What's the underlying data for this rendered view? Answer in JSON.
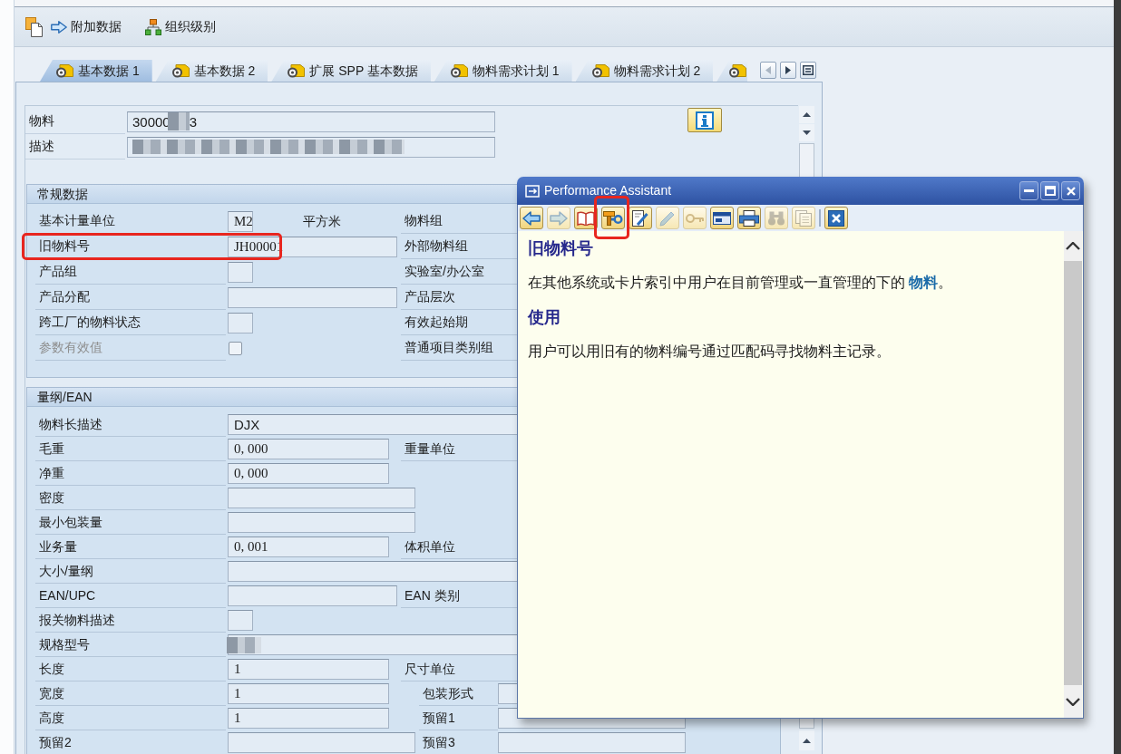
{
  "toolbar": {
    "items": [
      {
        "kind": "document"
      },
      {
        "kind": "arrow",
        "label": "附加数据"
      },
      {
        "kind": "org",
        "label": "组织级别"
      }
    ]
  },
  "tabs": [
    {
      "label": "基本数据 1",
      "selected": true
    },
    {
      "label": "基本数据 2",
      "selected": false
    },
    {
      "label": "扩展 SPP 基本数据",
      "selected": false
    },
    {
      "label": "物料需求计划 1",
      "selected": false
    },
    {
      "label": "物料需求计划 2",
      "selected": false
    },
    {
      "selected": false
    }
  ],
  "tab_nav": [
    {
      "kind": "prev",
      "disabled": true
    },
    {
      "kind": "next",
      "disabled": false
    },
    {
      "kind": "list",
      "disabled": false
    }
  ],
  "header": {
    "fields": [
      {
        "label": "物料",
        "value": "30000",
        "value_end": "3",
        "redacted": true
      },
      {
        "label": "描述",
        "redacted": true
      }
    ]
  },
  "sections": [
    {
      "title": "常规数据",
      "rows": [
        {
          "label": "基本计量单位",
          "disabled": false,
          "annotated": false,
          "field": {
            "kind": "short",
            "value": "M2"
          },
          "unit": "平方米",
          "label_2": "物料组"
        },
        {
          "label": "旧物料号",
          "disabled": false,
          "annotated": true,
          "field": {
            "kind": "wide",
            "value": "JH00001"
          },
          "label_2": "外部物料组"
        },
        {
          "label": "产品组",
          "disabled": false,
          "annotated": false,
          "field": {
            "kind": "short"
          },
          "label_2": "实验室/办公室"
        },
        {
          "label": "产品分配",
          "disabled": false,
          "annotated": false,
          "field": {
            "kind": "wide"
          },
          "label_2": "产品层次"
        },
        {
          "label": "跨工厂的物料状态",
          "disabled": false,
          "annotated": false,
          "field": {
            "kind": "short"
          },
          "label_2": "有效起始期"
        },
        {
          "label": "参数有效值",
          "disabled": true,
          "annotated": false,
          "field": {
            "kind": "checkbox",
            "checked": false
          },
          "label_2": "普通项目类别组"
        }
      ]
    },
    {
      "title": "量纲/EAN",
      "rows": [
        {
          "label": "物料长描述",
          "disabled": false,
          "annotated": false,
          "field": {
            "kind": "full",
            "value": "DJX"
          }
        },
        {
          "label": "毛重",
          "disabled": false,
          "annotated": false,
          "field": {
            "kind": "medium",
            "value": "0, 000"
          },
          "label_2": "重量单位"
        },
        {
          "label": "净重",
          "disabled": false,
          "annotated": false,
          "field": {
            "kind": "medium",
            "value": "0, 000"
          }
        },
        {
          "label": "密度",
          "disabled": false,
          "annotated": false,
          "field": {
            "kind": "long"
          }
        },
        {
          "label": "最小包装量",
          "disabled": false,
          "annotated": false,
          "field": {
            "kind": "long"
          }
        },
        {
          "label": "业务量",
          "disabled": false,
          "annotated": false,
          "field": {
            "kind": "medium",
            "value": "0, 001"
          },
          "label_2": "体积单位"
        },
        {
          "label": "大小/量纲",
          "disabled": false,
          "annotated": false,
          "field": {
            "kind": "full"
          }
        },
        {
          "label": "EAN/UPC",
          "disabled": false,
          "annotated": false,
          "field": {
            "kind": "wide"
          },
          "label_2": "EAN 类别"
        },
        {
          "label": "报关物料描述",
          "disabled": false,
          "annotated": false,
          "field": {
            "kind": "short"
          }
        },
        {
          "label": "规格型号",
          "disabled": false,
          "annotated": false,
          "field": {
            "kind": "redacted"
          }
        },
        {
          "label": "长度",
          "disabled": false,
          "annotated": false,
          "field": {
            "kind": "medium",
            "value": "1"
          },
          "label_2": "尺寸单位"
        },
        {
          "label": "宽度",
          "disabled": false,
          "annotated": false,
          "field": {
            "kind": "medium",
            "value": "1"
          },
          "label_2": "包装形式",
          "field_2": {
            "kind": "side"
          }
        },
        {
          "label": "高度",
          "disabled": false,
          "annotated": false,
          "field": {
            "kind": "medium",
            "value": "1"
          },
          "label_2": "预留1",
          "field_2": {
            "kind": "side"
          }
        },
        {
          "label": "预留2",
          "disabled": false,
          "annotated": false,
          "field": {
            "kind": "long"
          },
          "label_2": "预留3",
          "field_2": {
            "kind": "side"
          }
        }
      ]
    }
  ],
  "popup": {
    "title": "Performance Assistant",
    "toolbar": [
      {
        "kind": "back",
        "disabled": false,
        "annotated": false
      },
      {
        "kind": "forward",
        "disabled": true,
        "annotated": false
      },
      {
        "kind": "book",
        "disabled": false,
        "annotated": false
      },
      {
        "kind": "tools",
        "disabled": false,
        "annotated": true
      },
      {
        "kind": "edit",
        "disabled": false,
        "annotated": false
      },
      {
        "kind": "pencil",
        "disabled": true,
        "annotated": false
      },
      {
        "kind": "key",
        "disabled": true,
        "annotated": false
      },
      {
        "kind": "window",
        "disabled": false,
        "annotated": false
      },
      {
        "kind": "print",
        "disabled": false,
        "annotated": false
      },
      {
        "kind": "binoculars",
        "disabled": true,
        "annotated": false
      },
      {
        "kind": "pages",
        "disabled": true,
        "annotated": false
      },
      {
        "kind": "close",
        "disabled": false,
        "annotated": false
      }
    ],
    "content": [
      {
        "kind": "heading",
        "text": "旧物料号"
      },
      {
        "kind": "paragraph",
        "text": "在其他系统或卡片索引中用户在目前管理或一直管理的下的",
        "link": "物料",
        "text_after": "。"
      },
      {
        "kind": "heading",
        "text": "使用"
      },
      {
        "kind": "paragraph",
        "text": "用户可以用旧有的物料编号通过匹配码寻找物料主记录。"
      }
    ]
  }
}
